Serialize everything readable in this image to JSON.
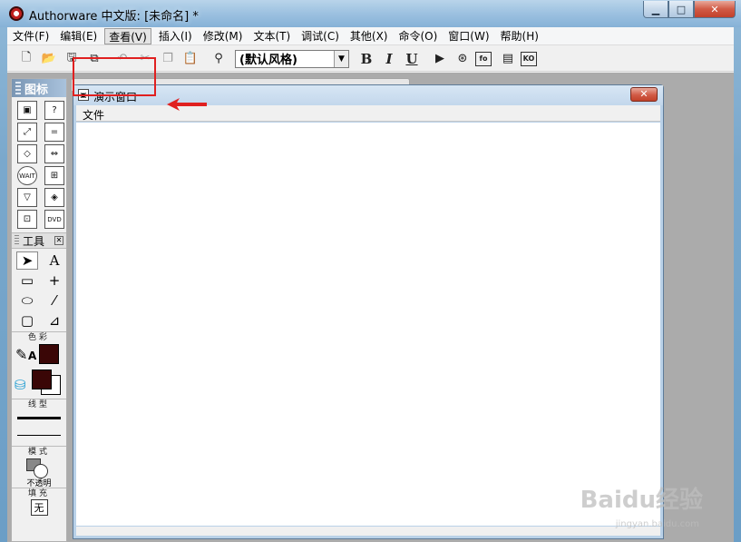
{
  "window": {
    "title": "Authorware 中文版: [未命名] *",
    "minimize_glyph": "▁",
    "maximize_glyph": "□",
    "close_glyph": "✕"
  },
  "menubar": {
    "items": [
      "文件(F)",
      "编辑(E)",
      "查看(V)",
      "插入(I)",
      "修改(M)",
      "文本(T)",
      "调试(C)",
      "其他(X)",
      "命令(O)",
      "窗口(W)",
      "帮助(H)"
    ],
    "active_index": 2
  },
  "toolbar": {
    "style_value": "(默认风格)",
    "bold_label": "B",
    "italic_label": "I",
    "underline_label": "U",
    "fo_label": "fo",
    "ko_label": "KO"
  },
  "palette": {
    "icons_title": "图标",
    "wait_label": "WAIT",
    "dvd_label": "DVD",
    "tools_title": "工具",
    "tool_text_label": "A",
    "color_label": "色彩",
    "line_label": "线型",
    "mode_label": "模式",
    "mode_value": "不透明",
    "fill_label": "填充",
    "fill_value": "无",
    "stroke_color": "#3a0606",
    "fill_color": "#3a0606"
  },
  "presentation": {
    "title": "演示窗口",
    "menu_item": "文件",
    "close_glyph": "✕"
  },
  "annotation": {
    "highlight_color": "#e02020"
  },
  "watermark": {
    "text": "Baidu经验",
    "url": "jingyan.baidu.com"
  }
}
